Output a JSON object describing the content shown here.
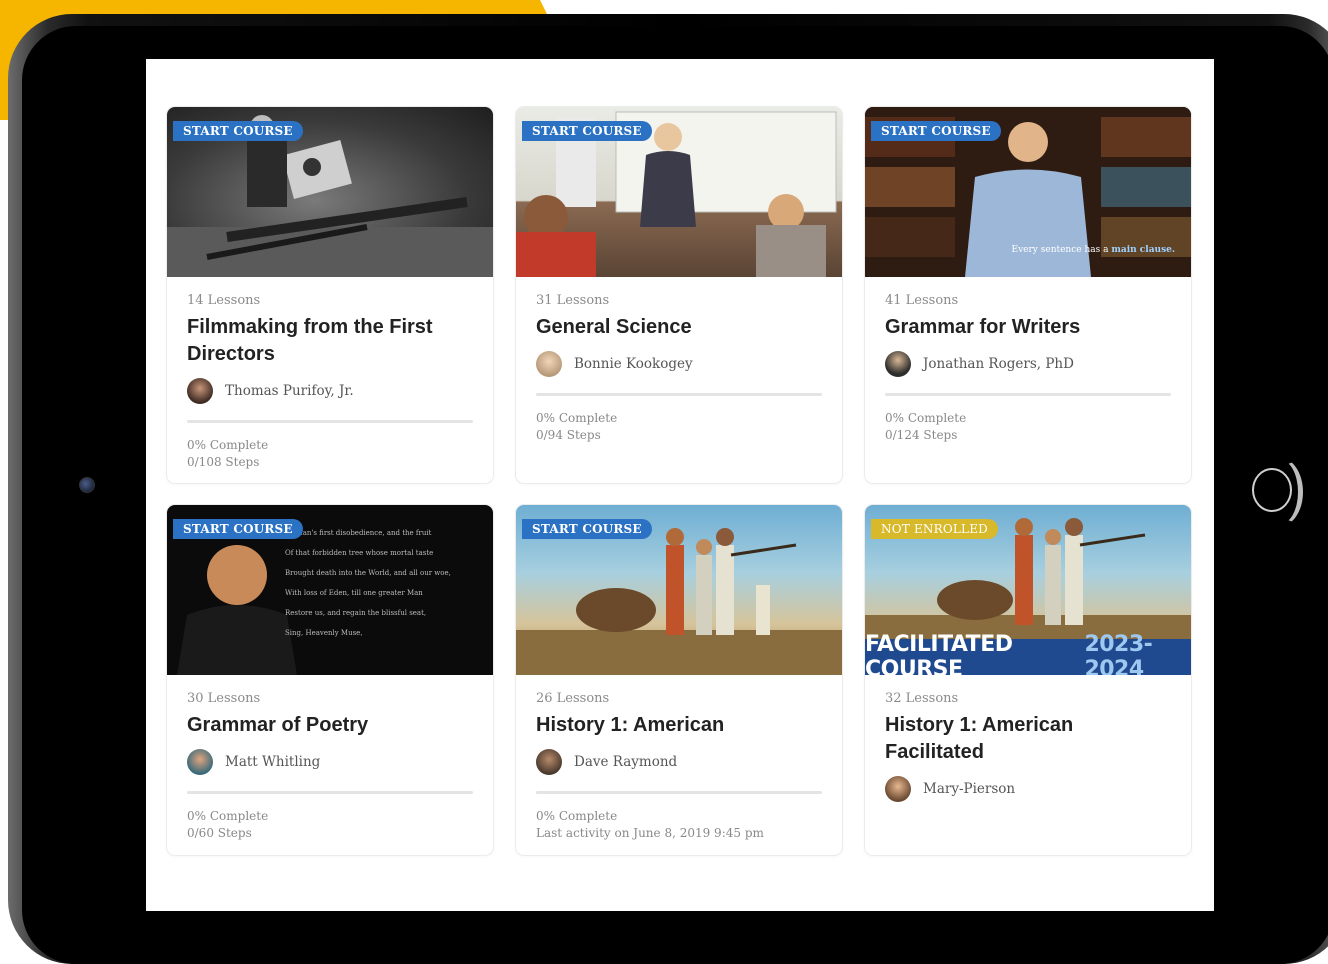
{
  "courses": [
    {
      "badge": "START COURSE",
      "lessons": "14 Lessons",
      "title": "Filmmaking from the First Directors",
      "instructor": "Thomas Purifoy, Jr.",
      "progress_percent": 0,
      "status_line1": "0% Complete",
      "status_line2": "0/108 Steps"
    },
    {
      "badge": "START COURSE",
      "lessons": "31 Lessons",
      "title": "General Science",
      "instructor": "Bonnie Kookogey",
      "progress_percent": 0,
      "status_line1": "0% Complete",
      "status_line2": "0/94 Steps"
    },
    {
      "badge": "START COURSE",
      "lessons": "41 Lessons",
      "title": "Grammar for Writers",
      "instructor": "Jonathan Rogers, PhD",
      "progress_percent": 0,
      "status_line1": "0% Complete",
      "status_line2": "0/124 Steps",
      "thumb_caption_pre": "Every sentence has a",
      "thumb_caption_em": "main clause."
    },
    {
      "badge": "START COURSE",
      "lessons": "30 Lessons",
      "title": "Grammar of Poetry",
      "instructor": "Matt Whitling",
      "progress_percent": 0,
      "status_line1": "0% Complete",
      "status_line2": "0/60 Steps",
      "poem_lines": [
        "Of Man's first disobedience, and the fruit",
        "Of that forbidden tree whose mortal taste",
        "Brought death into the World, and all our woe,",
        "With loss of Eden, till one greater Man",
        "Restore us, and regain the blissful seat,",
        "Sing, Heavenly Muse,"
      ]
    },
    {
      "badge": "START COURSE",
      "lessons": "26 Lessons",
      "title": "History 1: American",
      "instructor": "Dave Raymond",
      "progress_percent": 0,
      "status_line1": "0% Complete",
      "status_line2": "Last activity on June 8, 2019 9:45 pm"
    },
    {
      "badge": "NOT ENROLLED",
      "lessons": "32 Lessons",
      "title": "History 1: American Facilitated",
      "instructor": "Mary-Pierson",
      "banner_main": "FACILITATED COURSE",
      "banner_year": "2023-2024"
    }
  ],
  "colors": {
    "accent_blue": "#2b72c4",
    "badge_yellow": "#d7b92a",
    "background_yellow": "#f6b600"
  }
}
